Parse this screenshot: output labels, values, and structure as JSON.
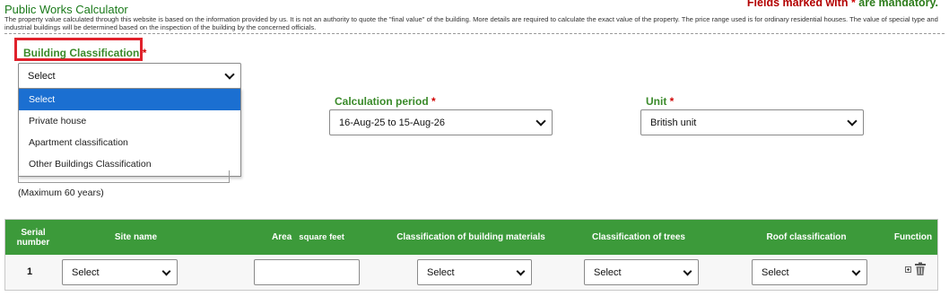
{
  "header": {
    "title": "Public Works Calculator",
    "mandatory_prefix": "Fields marked with",
    "mandatory_star": "*",
    "mandatory_suffix": "are mandatory.",
    "disclaimer": "The property value calculated through this website is based on the information provided by us. It is not an authority to quote the \"final value\" of the building. More details are required to calculate the exact value of the property. The price range used is for ordinary residential houses. The value of special type and industrial buildings will be determined based on the inspection of the building by the concerned officials."
  },
  "form": {
    "building_classification": {
      "label": "Building Classification",
      "required_mark": "*",
      "value": "Select",
      "options": [
        "Select",
        "Private house",
        "Apartment classification",
        "Other Buildings Classification"
      ]
    },
    "calculation_period": {
      "label": "Calculation period",
      "required_mark": "*",
      "value": "16-Aug-25 to 15-Aug-26"
    },
    "unit": {
      "label": "Unit",
      "required_mark": "*",
      "value": "British unit"
    },
    "age_note": "(Maximum 60 years)"
  },
  "table": {
    "headers": {
      "serial": "Serial number",
      "site_name": "Site name",
      "area": "Area",
      "area_unit": "square feet",
      "materials": "Classification of building materials",
      "trees": "Classification of trees",
      "roof": "Roof classification",
      "function": "Function"
    },
    "rows": [
      {
        "serial": "1",
        "site_name": "Select",
        "area": "",
        "materials": "Select",
        "trees": "Select",
        "roof": "Select"
      }
    ]
  },
  "colors": {
    "title_green": "#1a7a1a",
    "table_header_green": "#3c9a3a",
    "mandatory_red": "#b30000",
    "highlight_red": "#e0212b",
    "dropdown_selected_blue": "#1b6fd1"
  },
  "icons": [
    "chevron-down-icon",
    "expand-plus-icon",
    "trash-icon"
  ]
}
